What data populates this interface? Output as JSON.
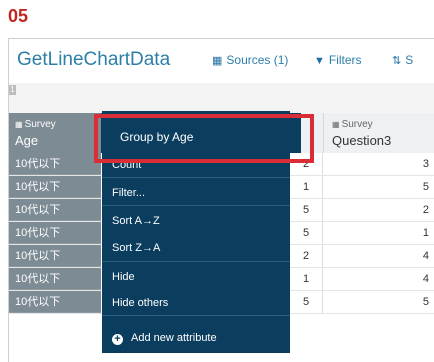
{
  "step_number": "05",
  "toolbar": {
    "title": "GetLineChartData",
    "sources_label": "Sources (1)",
    "filters_label": "Filters",
    "sort_label": "S",
    "sources_icon": "table-grid-icon",
    "filters_icon": "funnel-icon",
    "sort_icon": "sort-icon"
  },
  "badge": "1",
  "columns": {
    "age": {
      "source": "Survey",
      "name": "Age"
    },
    "q3": {
      "source": "Survey",
      "name": "Question3"
    }
  },
  "rows": [
    {
      "age": "10代以下",
      "mid": "2",
      "q3": "3"
    },
    {
      "age": "10代以下",
      "mid": "1",
      "q3": "5"
    },
    {
      "age": "10代以下",
      "mid": "5",
      "q3": "2"
    },
    {
      "age": "10代以下",
      "mid": "5",
      "q3": "1"
    },
    {
      "age": "10代以下",
      "mid": "2",
      "q3": "4"
    },
    {
      "age": "10代以下",
      "mid": "1",
      "q3": "4"
    },
    {
      "age": "10代以下",
      "mid": "5",
      "q3": "5"
    }
  ],
  "menu": {
    "group_label": "Group by Age",
    "count": "Count",
    "filter": "Filter...",
    "sort_az": "Sort A→Z",
    "sort_za": "Sort Z→A",
    "hide": "Hide",
    "hide_others": "Hide others",
    "add_attribute": "Add new attribute",
    "add_icon": "plus-circle-icon"
  },
  "colors": {
    "accent": "#2c7fa8",
    "menu_bg": "#0b3d5e",
    "highlight": "#d92e36",
    "step": "#c0281e"
  }
}
